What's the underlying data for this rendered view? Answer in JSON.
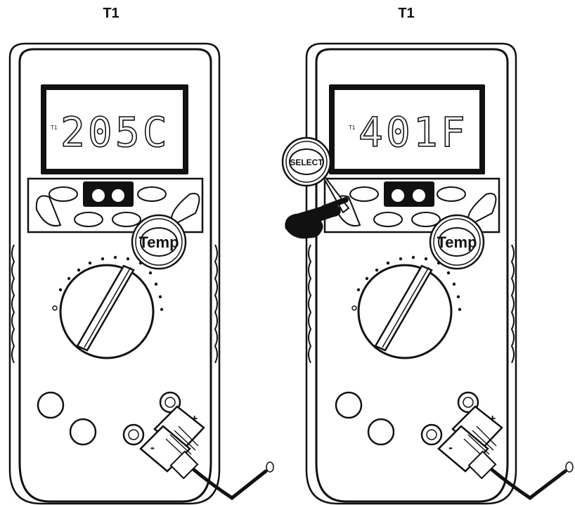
{
  "panels": [
    {
      "title": "T1",
      "display_indicator": "T1",
      "display_reading": "205C",
      "temp_button_label": "Temp",
      "terminal_plus": "+",
      "terminal_minus": "-"
    },
    {
      "title": "T1",
      "display_indicator": "T1",
      "display_reading": "401F",
      "temp_button_label": "Temp",
      "select_button_label": "SELECT",
      "terminal_plus": "+",
      "terminal_minus": "-"
    }
  ]
}
